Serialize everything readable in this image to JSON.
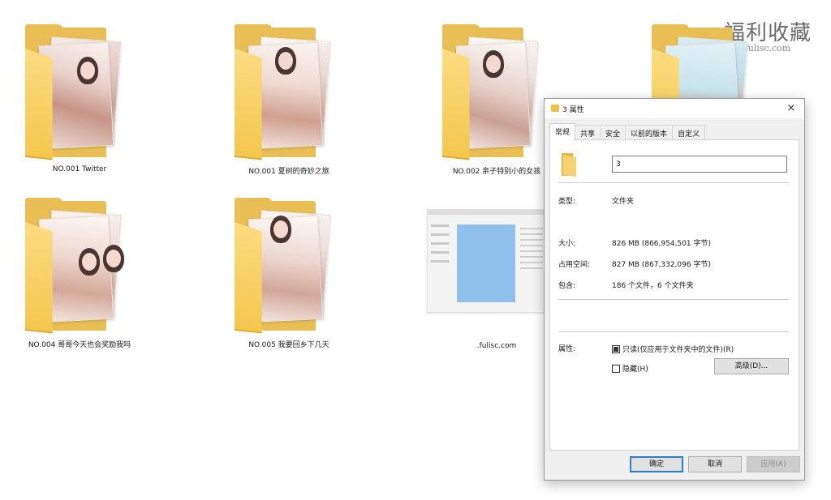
{
  "watermark": {
    "title": "福利收藏",
    "url": "fulisc.com"
  },
  "desktop": {
    "items": [
      {
        "label": "NO.001 Twitter"
      },
      {
        "label": "NO.001 夏树的奇妙之旅"
      },
      {
        "label": "NO.002 亲子特别小的女孩"
      },
      {
        "label": "NO.004 哥哥今天也会奖励我吗"
      },
      {
        "label": "NO.005 我要回乡下几天"
      },
      {
        "label": ".fulisc.com"
      }
    ]
  },
  "dialog": {
    "title": "3 属性",
    "close": "×",
    "tabs": [
      "常规",
      "共享",
      "安全",
      "以前的版本",
      "自定义"
    ],
    "name_value": "3",
    "type_label": "类型:",
    "type_value": "文件夹",
    "size_label": "大小:",
    "size_value": "826 MB (866,954,501 字节)",
    "disk_label": "占用空间:",
    "disk_value": "827 MB (867,332,096 字节)",
    "contains_label": "包含:",
    "contains_value": "186 个文件，6 个文件夹",
    "attr_label": "属性:",
    "readonly_label": "只读(仅应用于文件夹中的文件)(R)",
    "hidden_label": "隐藏(H)",
    "advanced_button": "高级(D)...",
    "ok_button": "确定",
    "cancel_button": "取消",
    "apply_button": "应用(A)"
  }
}
